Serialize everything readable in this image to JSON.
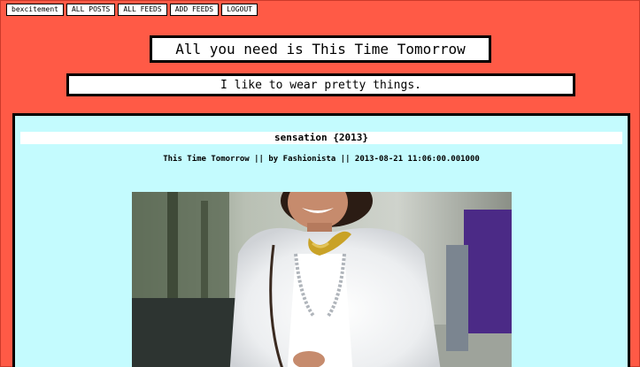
{
  "nav": {
    "items": [
      {
        "label": "bexcitement"
      },
      {
        "label": "ALL POSTS"
      },
      {
        "label": "ALL FEEDS"
      },
      {
        "label": "ADD FEEDS"
      },
      {
        "label": "LOGOUT"
      }
    ]
  },
  "header": {
    "title": "All you need is This Time Tomorrow",
    "subtitle": "I like to wear pretty things."
  },
  "post": {
    "title": "sensation {2013}",
    "meta": "This Time Tomorrow || by Fashionista || 2013-08-21 11:06:00.001000",
    "image": {
      "subject": "street-style photo of a smiling woman in a white feather jacket and gold chain necklace"
    }
  },
  "colors": {
    "page_background": "#ff5a46",
    "panel_background": "#c4fbfe",
    "border": "#000000"
  }
}
